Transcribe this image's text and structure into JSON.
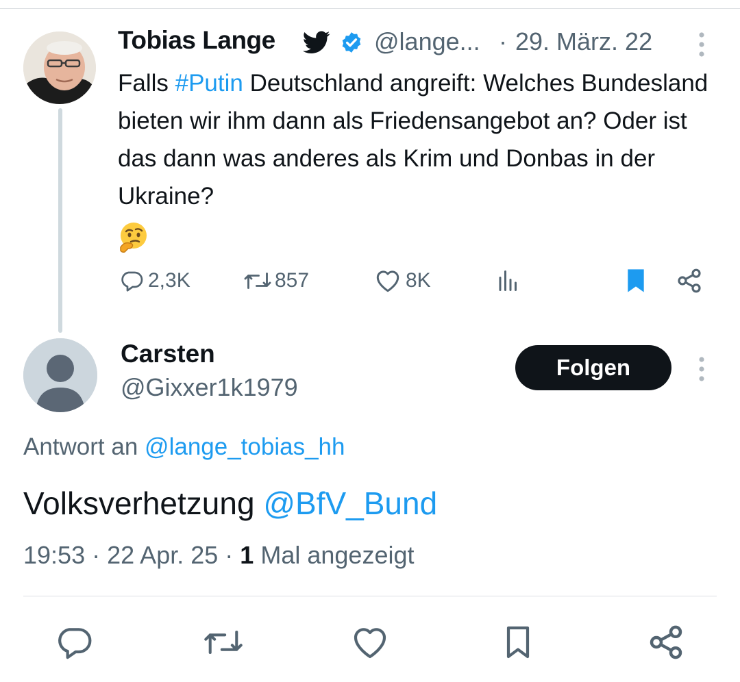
{
  "parent_tweet": {
    "author_name": "Tobias Lange",
    "handle": "@lange...",
    "separator": "·",
    "date": "29. März. 22",
    "text_before_hashtag": "Falls ",
    "hashtag": "#Putin",
    "text_after_hashtag": " Deutschland angreift: Welches Bundesland bieten wir ihm dann als Friedensangebot an? Oder ist das dann was anderes als Krim und Donbas in der Ukraine?",
    "emoji": "thinking-face",
    "stats": {
      "replies": "2,3K",
      "reposts": "857",
      "likes": "8K"
    },
    "icons": {
      "bird": "twitter-bird-icon",
      "verified": "verified-badge-icon",
      "more": "more-vertical-icon",
      "reply": "reply-icon",
      "repost": "repost-icon",
      "like": "heart-icon",
      "views": "analytics-icon",
      "bookmark": "bookmark-filled-icon",
      "share": "share-icon"
    }
  },
  "reply_tweet": {
    "author_name": "Carsten",
    "handle": "@Gixxer1k1979",
    "follow_label": "Folgen",
    "reply_to_prefix": "Antwort an ",
    "reply_to_handle": "@lange_tobias_hh",
    "text": "Volksverhetzung ",
    "text_mention": "@BfV_Bund",
    "time": "19:53",
    "date": "22 Apr. 25",
    "view_count": "1",
    "view_label": "Mal angezeigt",
    "separator": "·"
  },
  "colors": {
    "accent": "#1d9bf0",
    "text": "#0f1419",
    "secondary": "#536471",
    "bookmark": "#1d9bf0",
    "divider": "#dcdfe3"
  }
}
